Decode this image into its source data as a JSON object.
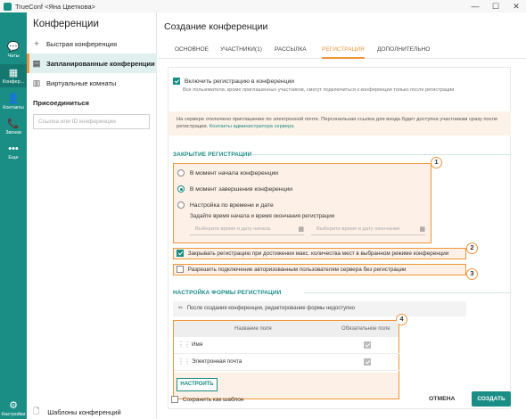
{
  "window": {
    "title": "TrueConf <Яна Цветкова>",
    "minimize": "—",
    "maximize": "☐",
    "close": "✕"
  },
  "rail": {
    "items": [
      {
        "icon": "💬",
        "label": "Чаты"
      },
      {
        "icon": "▦",
        "label": "Конфер..."
      },
      {
        "icon": "👤",
        "label": "Контакты"
      },
      {
        "icon": "📞",
        "label": "Звонки"
      },
      {
        "icon": "•••",
        "label": "Еще"
      }
    ],
    "settings": {
      "icon": "⚙",
      "label": "Настройки"
    }
  },
  "sidebar": {
    "title": "Конференции",
    "items": [
      {
        "icon": "+",
        "label": "Быстрая конференция"
      },
      {
        "icon": "▤",
        "label": "Запланированные конференции"
      },
      {
        "icon": "▥",
        "label": "Виртуальные комнаты"
      }
    ],
    "join_label": "Присоединиться",
    "search_placeholder": "Ссылка или ID конференции",
    "templates_icon": "🗋",
    "templates_label": "Шаблоны конференций"
  },
  "main": {
    "title": "Создание конференции",
    "tabs": [
      "ОСНОВНОЕ",
      "УЧАСТНИКИ(1)",
      "РАССЫЛКА",
      "РЕГИСТРАЦИЯ",
      "ДОПОЛНИТЕЛЬНО"
    ],
    "active_tab": "РЕГИСТРАЦИЯ"
  },
  "registration": {
    "enable_label": "Включить регистрацию в конференции",
    "enable_checked": true,
    "enable_hint": "Все пользователи, кроме приглашенных участников, смогут подключиться к конференции только после регистрации",
    "info_text": "На сервере отключено приглашение по электронной почте. Персональная ссылка для входа будет доступна участникам сразу после регистрации.",
    "info_link": "Контакты администратора сервера",
    "close_section_title": "ЗАКРЫТИЕ РЕГИСТРАЦИИ",
    "radio_options": [
      {
        "label": "В момент начала конференции",
        "selected": false
      },
      {
        "label": "В момент завершения конференции",
        "selected": true
      },
      {
        "label": "Настройка по времени и дате",
        "selected": false
      }
    ],
    "time_hint": "Задайте время начала и время окончания регистрации",
    "start_picker_placeholder": "Выберите время и дату начала",
    "end_picker_placeholder": "Выберите время и дату окончания",
    "calendar_icon": "▦",
    "close_on_max_label": "Закрывать регистрацию при достижении макс. количества мест в выбранном режиме конференции",
    "close_on_max_checked": true,
    "allow_auth_label": "Разрешить подключение авторизованным пользователям сервера без регистрации",
    "allow_auth_checked": false,
    "form_section_title": "НАСТРОЙКА ФОРМЫ РЕГИСТРАЦИИ",
    "form_notice_icon": "✂",
    "form_notice": "После создания конференции, редактирование формы недоступно",
    "table": {
      "col_name": "Название поля",
      "col_required": "Обязательное поле",
      "rows": [
        {
          "name": "Имя",
          "required": true
        },
        {
          "name": "Электронная почта",
          "required": true
        }
      ]
    },
    "configure_button": "НАСТРОИТЬ"
  },
  "badges": [
    "1",
    "2",
    "3",
    "4"
  ],
  "footer": {
    "save_template_label": "Сохранить как шаблон",
    "save_template_checked": false,
    "cancel_button": "ОТМЕНА",
    "create_button": "СОЗДАТЬ"
  },
  "colors": {
    "accent": "#1a8d85",
    "highlight": "#f0963a",
    "highlight_fill": "#fdf0e6"
  }
}
